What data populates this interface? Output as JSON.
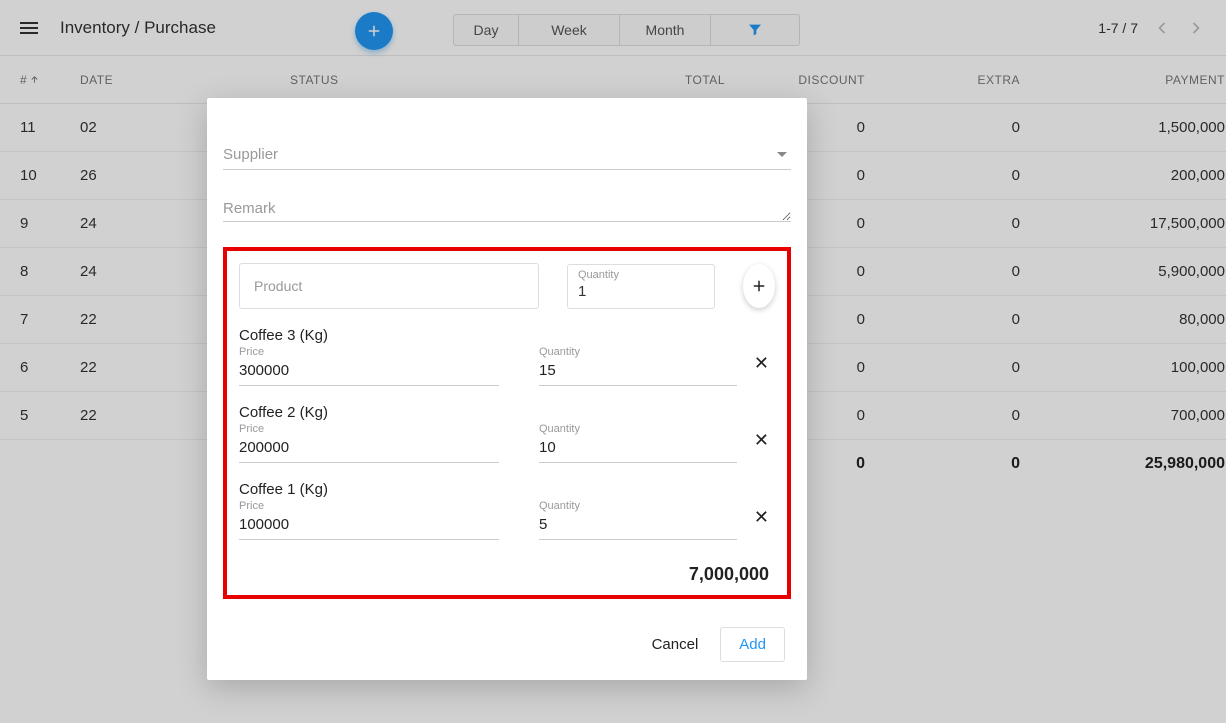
{
  "header": {
    "title": "Inventory / Purchase",
    "range_tabs": {
      "day": "Day",
      "week": "Week",
      "month": "Month"
    }
  },
  "pager": {
    "label": "1-7 / 7"
  },
  "table": {
    "columns": {
      "num": "#",
      "date": "DATE",
      "status": "STATUS",
      "total": "TOTAL",
      "discount": "DISCOUNT",
      "extra": "EXTRA",
      "payment": "PAYMENT"
    },
    "rows": [
      {
        "num": "11",
        "date": "02",
        "discount": "0",
        "extra": "0",
        "payment": "1,500,000"
      },
      {
        "num": "10",
        "date": "26",
        "discount": "0",
        "extra": "0",
        "payment": "200,000"
      },
      {
        "num": "9",
        "date": "24",
        "discount": "0",
        "extra": "0",
        "payment": "17,500,000"
      },
      {
        "num": "8",
        "date": "24",
        "discount": "0",
        "extra": "0",
        "payment": "5,900,000"
      },
      {
        "num": "7",
        "date": "22",
        "discount": "0",
        "extra": "0",
        "payment": "80,000"
      },
      {
        "num": "6",
        "date": "22",
        "discount": "0",
        "extra": "0",
        "payment": "100,000"
      },
      {
        "num": "5",
        "date": "22",
        "discount": "0",
        "extra": "0",
        "payment": "700,000"
      }
    ],
    "footer": {
      "discount": "0",
      "extra": "0",
      "payment": "25,980,000"
    }
  },
  "modal": {
    "supplier_placeholder": "Supplier",
    "remark_placeholder": "Remark",
    "product_placeholder": "Product",
    "quantity_label": "Quantity",
    "quantity_value": "1",
    "price_label": "Price",
    "items": [
      {
        "name": "Coffee 3 (Kg)",
        "price": "300000",
        "qty": "15"
      },
      {
        "name": "Coffee 2 (Kg)",
        "price": "200000",
        "qty": "10"
      },
      {
        "name": "Coffee 1 (Kg)",
        "price": "100000",
        "qty": "5"
      }
    ],
    "subtotal": "7,000,000",
    "actions": {
      "cancel": "Cancel",
      "add": "Add"
    }
  }
}
